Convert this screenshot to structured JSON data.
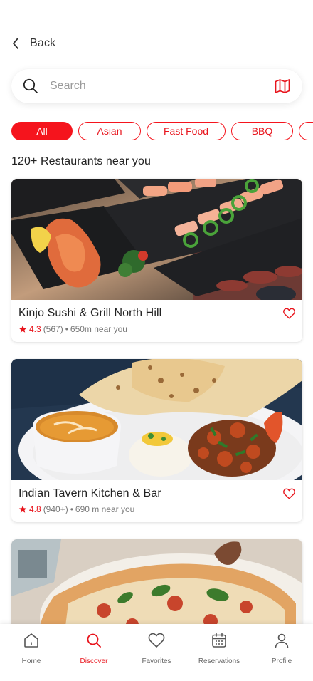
{
  "header": {
    "back_label": "Back"
  },
  "search": {
    "placeholder": "Search"
  },
  "filters": [
    {
      "label": "All",
      "active": true
    },
    {
      "label": "Asian",
      "active": false
    },
    {
      "label": "Fast Food",
      "active": false
    },
    {
      "label": "BBQ",
      "active": false
    },
    {
      "label": "",
      "active": false
    }
  ],
  "section_heading": "120+ Restaurants near you",
  "restaurants": [
    {
      "name": "Kinjo Sushi & Grill North Hill",
      "rating": "4.3",
      "reviews": "(567)",
      "separator": "•",
      "distance": "650m near you"
    },
    {
      "name": "Indian Tavern Kitchen & Bar",
      "rating": "4.8",
      "reviews": "(940+)",
      "separator": "•",
      "distance": "690 m near you"
    },
    {
      "name": "",
      "rating": "",
      "reviews": "",
      "separator": "",
      "distance": ""
    }
  ],
  "nav": {
    "items": [
      {
        "label": "Home",
        "icon": "home-icon"
      },
      {
        "label": "Discover",
        "icon": "search-icon"
      },
      {
        "label": "Favorites",
        "icon": "heart-icon"
      },
      {
        "label": "Reservations",
        "icon": "calendar-icon"
      },
      {
        "label": "Profile",
        "icon": "user-icon"
      }
    ],
    "active": "Discover"
  },
  "colors": {
    "accent": "#f5141d",
    "text": "#222222",
    "muted": "#777777"
  }
}
